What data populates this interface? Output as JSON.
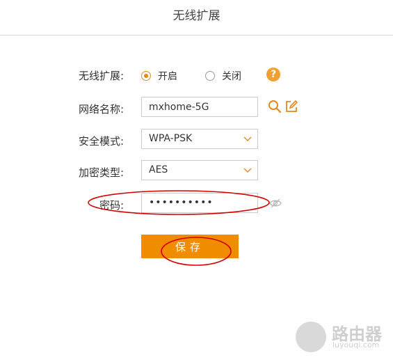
{
  "header": {
    "title": "无线扩展"
  },
  "form": {
    "extend": {
      "label": "无线扩展:",
      "options": [
        {
          "label": "开启",
          "selected": true
        },
        {
          "label": "关闭",
          "selected": false
        }
      ],
      "help_icon": "question-icon",
      "help_text": "?"
    },
    "ssid": {
      "label": "网络名称:",
      "value": "mxhome-5G",
      "icons": [
        "search-icon",
        "edit-icon"
      ]
    },
    "security": {
      "label": "安全模式:",
      "value": "WPA-PSK"
    },
    "encryption": {
      "label": "加密类型:",
      "value": "AES"
    },
    "password": {
      "label": "密码:",
      "value": "••••••••••",
      "icon": "eye-off-icon"
    }
  },
  "actions": {
    "save_label": "保存"
  },
  "watermark": {
    "text": "路由器",
    "sub": "luyouqi.com"
  },
  "colors": {
    "accent": "#f08c00",
    "annotation": "#d40000"
  }
}
